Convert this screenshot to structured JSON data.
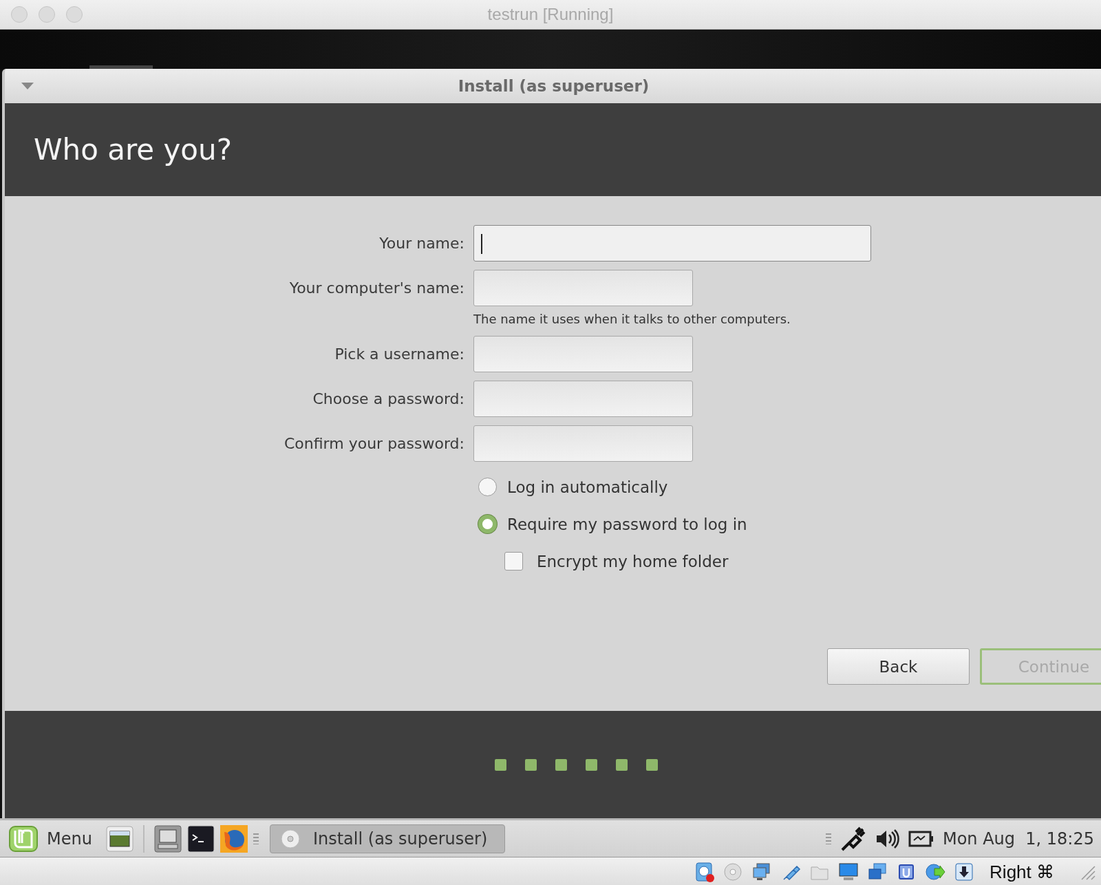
{
  "host_window": {
    "title": "testrun [Running]"
  },
  "installer": {
    "window_title": "Install (as superuser)",
    "heading": "Who are you?",
    "fields": [
      {
        "kind": "wide",
        "label": "Your name:",
        "focused": true
      },
      {
        "kind": "short",
        "label": "Your computer's name:",
        "focused": false,
        "hint": "The name it uses when it talks to other computers."
      },
      {
        "kind": "short",
        "label": "Pick a username:",
        "focused": false
      },
      {
        "kind": "short",
        "label": "Choose a password:",
        "focused": false
      },
      {
        "kind": "short",
        "label": "Confirm your password:",
        "focused": false
      }
    ],
    "options": [
      {
        "kind": "radio",
        "label": "Log in automatically",
        "selected": false
      },
      {
        "kind": "radio",
        "label": "Require my password to log in",
        "selected": true
      },
      {
        "kind": "checkbox",
        "label": "Encrypt my home folder",
        "checked": false
      }
    ],
    "buttons": [
      {
        "label": "Back",
        "disabled": false
      },
      {
        "label": "Continue",
        "disabled": true
      }
    ],
    "progress_dots": [
      {
        "done": true
      },
      {
        "done": true
      },
      {
        "done": true
      },
      {
        "done": true
      },
      {
        "done": true
      },
      {
        "done": true
      }
    ]
  },
  "taskbar": {
    "menu_label": "Menu",
    "window_button": {
      "label": "Install (as superuser)"
    },
    "clock": "Mon Aug  1, 18:25"
  },
  "status_bar": {
    "host_key": "Right ⌘"
  }
}
